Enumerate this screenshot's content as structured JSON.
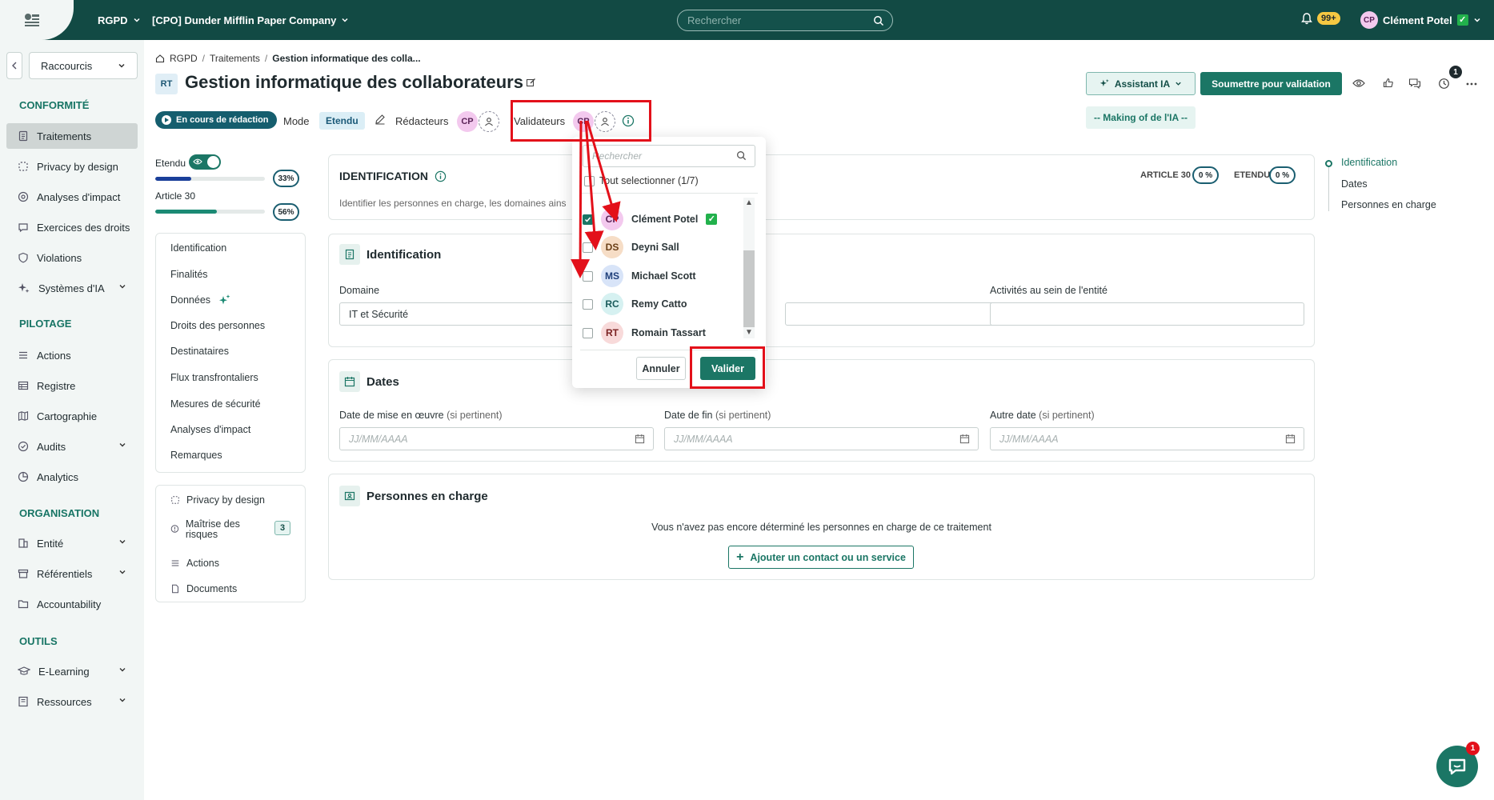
{
  "topbar": {
    "module": "RGPD",
    "company": "[CPO] Dunder Mifflin Paper Company",
    "search_placeholder": "Rechercher",
    "notifications_count": "99+",
    "user_initials": "CP",
    "user_name": "Clément Potel"
  },
  "sidebar": {
    "shortcut_label": "Raccourcis",
    "sections": [
      {
        "title": "CONFORMITÉ",
        "items": [
          "Traitements",
          "Privacy by design",
          "Analyses d'impact",
          "Exercices des droits",
          "Violations",
          "Systèmes d'IA"
        ]
      },
      {
        "title": "PILOTAGE",
        "items": [
          "Actions",
          "Registre",
          "Cartographie",
          "Audits",
          "Analytics"
        ]
      },
      {
        "title": "ORGANISATION",
        "items": [
          "Entité",
          "Référentiels",
          "Accountability"
        ]
      },
      {
        "title": "OUTILS",
        "items": [
          "E-Learning",
          "Ressources"
        ]
      }
    ]
  },
  "breadcrumb": [
    "RGPD",
    "Traitements",
    "Gestion informatique des colla..."
  ],
  "page": {
    "tile": "RT",
    "title": "Gestion informatique des collaborateurs",
    "status": "En cours de rédaction",
    "mode_label": "Mode",
    "mode_value": "Etendu",
    "redacteurs_label": "Rédacteurs",
    "validateurs_label": "Validateurs",
    "assistant_label": "Assistant IA",
    "submit_label": "Soumettre pour validation",
    "history_badge": "1",
    "making_of_label": "-- Making of de l'IA --"
  },
  "progress": {
    "etendu_label": "Etendu",
    "etendu_pct": "33%",
    "etendu_value": 0.33,
    "article_label": "Article 30",
    "article_pct": "56%",
    "article_value": 0.56
  },
  "section_nav": [
    "Identification",
    "Finalités",
    "Données",
    "Droits des personnes",
    "Destinataires",
    "Flux transfrontaliers",
    "Mesures de sécurité",
    "Analyses d'impact",
    "Remarques"
  ],
  "tools_nav": {
    "items": [
      "Privacy by design",
      "Maîtrise des risques",
      "Actions",
      "Documents"
    ],
    "risk_count": "3"
  },
  "identification_card": {
    "title": "IDENTIFICATION",
    "description": "Identifier les personnes en charge, les domaines ains",
    "article_label": "ARTICLE 30",
    "article_pct": "0 %",
    "etendu_label": "ETENDU",
    "etendu_pct": "0 %"
  },
  "ident_card": {
    "title": "Identification",
    "domain_label": "Domaine",
    "domain_value": "IT et Sécurité",
    "activities_label": "Activités au sein de l'entité"
  },
  "dates_card": {
    "title": "Dates",
    "start_label": "Date de mise en œuvre",
    "end_label": "Date de fin",
    "other_label": "Autre date",
    "optional": "(si pertinent)",
    "placeholder": "JJ/MM/AAAA"
  },
  "people_card": {
    "title": "Personnes en charge",
    "empty_text": "Vous n'avez pas encore déterminé les personnes en charge de ce traitement",
    "add_label": "Ajouter un contact ou un service"
  },
  "toc": [
    "Identification",
    "Dates",
    "Personnes en charge"
  ],
  "popup": {
    "search_placeholder": "Rechercher",
    "select_all": "Tout selectionner (1/7)",
    "options": [
      {
        "initials": "CP",
        "name": "Clément Potel",
        "checked": true,
        "bg": "#f3c9ee",
        "fg": "#5b2458"
      },
      {
        "initials": "DS",
        "name": "Deyni Sall",
        "checked": false,
        "bg": "#f6ddc6",
        "fg": "#6a3f17"
      },
      {
        "initials": "MS",
        "name": "Michael Scott",
        "checked": false,
        "bg": "#d8e4f8",
        "fg": "#1e3f7a"
      },
      {
        "initials": "RC",
        "name": "Remy Catto",
        "checked": false,
        "bg": "#d6f1f1",
        "fg": "#1a5b5b"
      },
      {
        "initials": "RT",
        "name": "Romain Tassart",
        "checked": false,
        "bg": "#f8dada",
        "fg": "#7a2222"
      }
    ],
    "cancel_label": "Annuler",
    "validate_label": "Valider"
  },
  "chat_badge": "1",
  "colors": {
    "primary": "#1b7665",
    "topbar": "#124a44",
    "annotation": "#e3101a"
  }
}
